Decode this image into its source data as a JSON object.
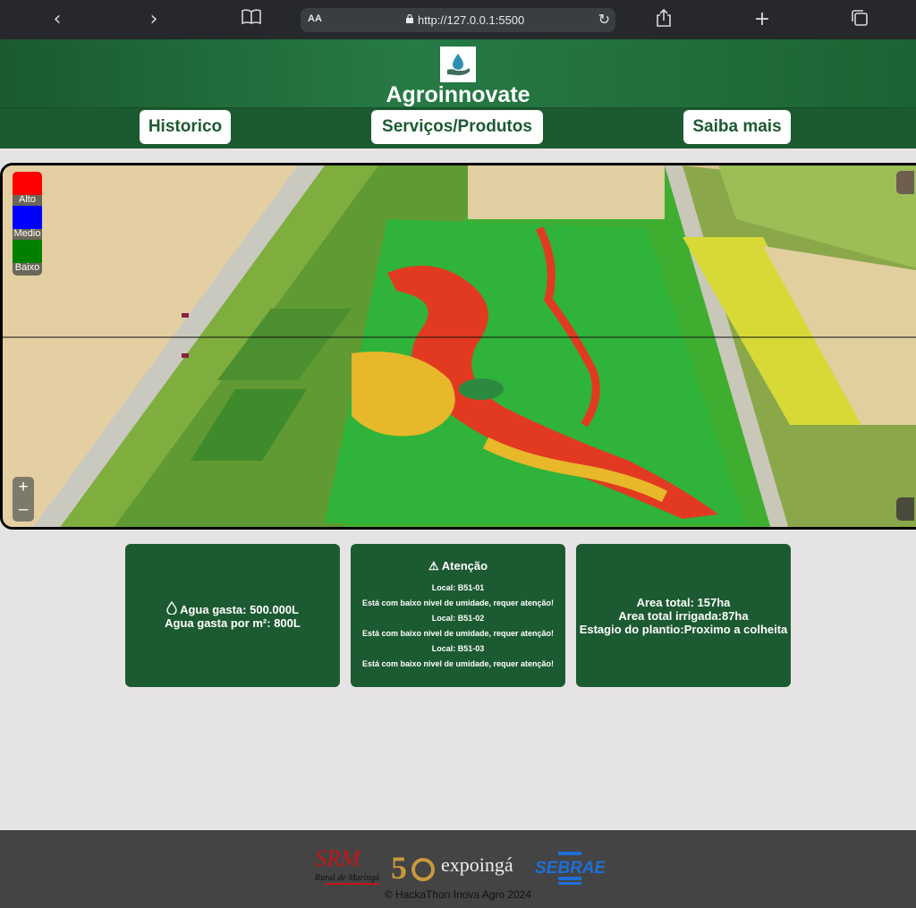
{
  "browser": {
    "text_size_label": "AA",
    "url": "http://127.0.0.1:5500"
  },
  "header": {
    "brand": "Agroinnovate",
    "nav": [
      "Historico",
      "Serviços/Produtos",
      "Saiba mais"
    ]
  },
  "map": {
    "legend": [
      {
        "label": "Alto",
        "color": "#ff0000"
      },
      {
        "label": "Medio",
        "color": "#0000ff"
      },
      {
        "label": "Baixo",
        "color": "#008000"
      }
    ],
    "zoom_in": "+",
    "zoom_out": "–"
  },
  "cards": {
    "water": {
      "spent": "Agua gasta: 500.000L",
      "per_m2": "Agua gasta por m²: 800L"
    },
    "alert": {
      "title": "Atenção",
      "items": [
        {
          "location": "Local: B51-01",
          "message": "Está com baixo nivel de umidade, requer atenção!"
        },
        {
          "location": "Local: B51-02",
          "message": "Está com baixo nivel de umidade, requer atenção!"
        },
        {
          "location": "Local: B51-03",
          "message": "Está com baixo nivel de umidade, requer atenção!"
        }
      ]
    },
    "area": {
      "total": "Area total: 157ha",
      "irrigated": "Area total irrigada:87ha",
      "stage": "Estagio do plantio:Proximo a colheita"
    }
  },
  "footer": {
    "logos": {
      "srm": "SRM",
      "srm_sub": "Rural de Maringá",
      "expo": "expoingá",
      "sebrae": "SEBRAE"
    },
    "copyright": "© HackaThon Inova Agro 2024"
  }
}
